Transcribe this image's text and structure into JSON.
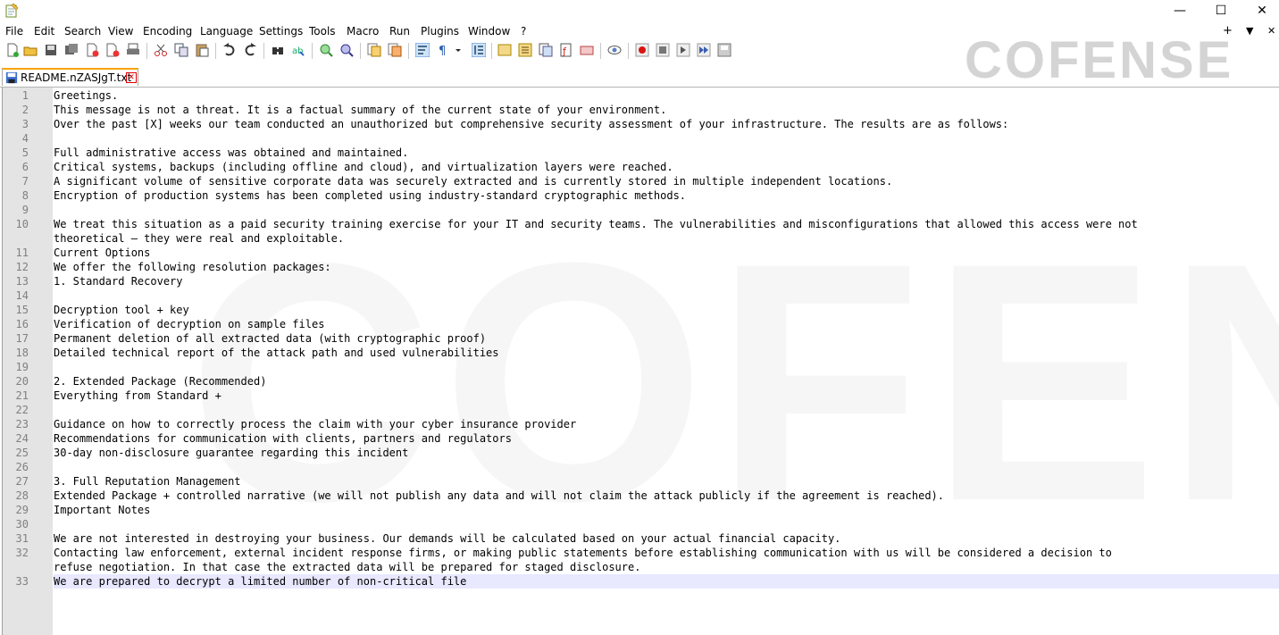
{
  "window": {
    "minimize_glyph": "—",
    "maximize_glyph": "☐",
    "close_glyph": "✕"
  },
  "menu": {
    "items": [
      "File",
      "Edit",
      "Search",
      "View",
      "Encoding",
      "Language",
      "Settings",
      "Tools",
      "Macro",
      "Run",
      "Plugins",
      "Window",
      "?"
    ],
    "right": [
      "+",
      "▼",
      "✕"
    ]
  },
  "watermark": {
    "text": "COFENSE"
  },
  "tab": {
    "label": "README.nZASJgT.txt",
    "close": "✕"
  },
  "editor": {
    "lines": [
      {
        "n": "1",
        "t": "Greetings."
      },
      {
        "n": "2",
        "t": "This message is not a threat. It is a factual summary of the current state of your environment."
      },
      {
        "n": "3",
        "t": "Over the past [X] weeks our team conducted an unauthorized but comprehensive security assessment of your infrastructure. The results are as follows:"
      },
      {
        "n": "4",
        "t": ""
      },
      {
        "n": "5",
        "t": "Full administrative access was obtained and maintained."
      },
      {
        "n": "6",
        "t": "Critical systems, backups (including offline and cloud), and virtualization layers were reached."
      },
      {
        "n": "7",
        "t": "A significant volume of sensitive corporate data was securely extracted and is currently stored in multiple independent locations."
      },
      {
        "n": "8",
        "t": "Encryption of production systems has been completed using industry-standard cryptographic methods."
      },
      {
        "n": "9",
        "t": ""
      },
      {
        "n": "10",
        "t": "We treat this situation as a paid security training exercise for your IT and security teams. The vulnerabilities and misconfigurations that allowed this access were not"
      },
      {
        "n": "",
        "t": "theoretical — they were real and exploitable."
      },
      {
        "n": "11",
        "t": "Current Options"
      },
      {
        "n": "12",
        "t": "We offer the following resolution packages:"
      },
      {
        "n": "13",
        "t": "1. Standard Recovery"
      },
      {
        "n": "14",
        "t": ""
      },
      {
        "n": "15",
        "t": "Decryption tool + key"
      },
      {
        "n": "16",
        "t": "Verification of decryption on sample files"
      },
      {
        "n": "17",
        "t": "Permanent deletion of all extracted data (with cryptographic proof)"
      },
      {
        "n": "18",
        "t": "Detailed technical report of the attack path and used vulnerabilities"
      },
      {
        "n": "19",
        "t": ""
      },
      {
        "n": "20",
        "t": "2. Extended Package (Recommended)"
      },
      {
        "n": "21",
        "t": "Everything from Standard +"
      },
      {
        "n": "22",
        "t": ""
      },
      {
        "n": "23",
        "t": "Guidance on how to correctly process the claim with your cyber insurance provider"
      },
      {
        "n": "24",
        "t": "Recommendations for communication with clients, partners and regulators"
      },
      {
        "n": "25",
        "t": "30-day non-disclosure guarantee regarding this incident"
      },
      {
        "n": "26",
        "t": ""
      },
      {
        "n": "27",
        "t": "3. Full Reputation Management"
      },
      {
        "n": "28",
        "t": "Extended Package + controlled narrative (we will not publish any data and will not claim the attack publicly if the agreement is reached)."
      },
      {
        "n": "29",
        "t": "Important Notes"
      },
      {
        "n": "30",
        "t": ""
      },
      {
        "n": "31",
        "t": "We are not interested in destroying your business. Our demands will be calculated based on your actual financial capacity."
      },
      {
        "n": "32",
        "t": "Contacting law enforcement, external incident response firms, or making public statements before establishing communication with us will be considered a decision to"
      },
      {
        "n": "",
        "t": "refuse negotiation. In that case the extracted data will be prepared for staged disclosure."
      },
      {
        "n": "33",
        "t": "We are prepared to decrypt a limited number of non-critical file"
      }
    ]
  }
}
